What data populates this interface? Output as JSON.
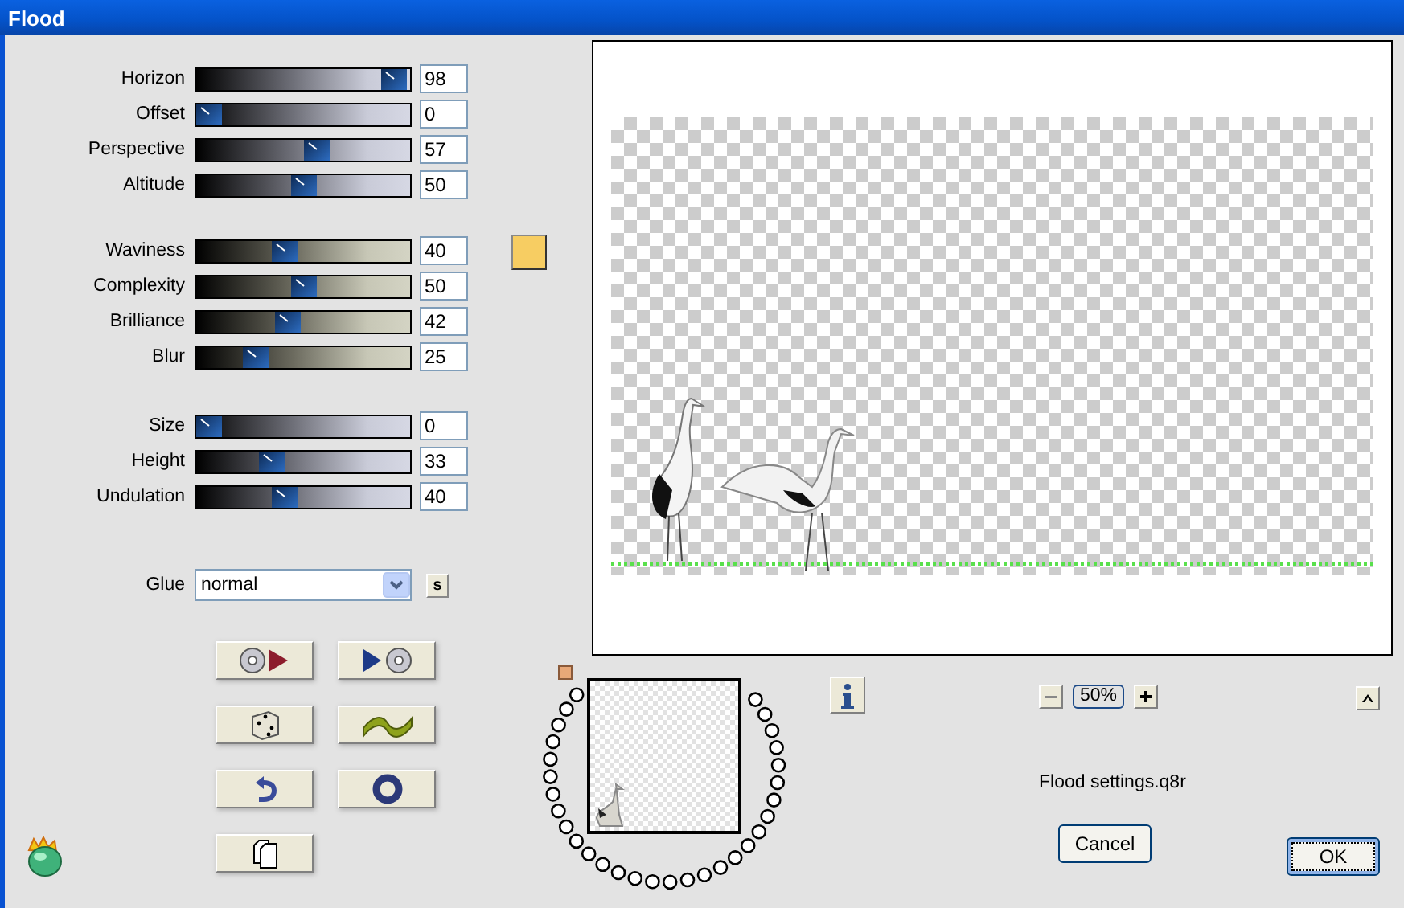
{
  "window": {
    "title": "Flood"
  },
  "slider_groups": [
    {
      "kind": "cool",
      "sliders": [
        {
          "label": "Horizon",
          "level": 0.98,
          "value": "98"
        },
        {
          "label": "Offset",
          "level": 0,
          "value": "0"
        },
        {
          "label": "Perspective",
          "level": 0.57,
          "value": "57"
        },
        {
          "label": "Altitude",
          "level": 0.5,
          "value": "50"
        }
      ]
    },
    {
      "kind": "warm",
      "sliders": [
        {
          "label": "Waviness",
          "level": 0.4,
          "value": "40"
        },
        {
          "label": "Complexity",
          "level": 0.5,
          "value": "50"
        },
        {
          "label": "Brilliance",
          "level": 0.42,
          "value": "42"
        },
        {
          "label": "Blur",
          "level": 0.25,
          "value": "25"
        }
      ]
    },
    {
      "kind": "cool",
      "sliders": [
        {
          "label": "Size",
          "level": 0,
          "value": "0"
        },
        {
          "label": "Height",
          "level": 0.33,
          "value": "33"
        },
        {
          "label": "Undulation",
          "level": 0.4,
          "value": "40"
        }
      ]
    }
  ],
  "color_swatch": {
    "color": "#f7cd62"
  },
  "glue": {
    "label": "Glue",
    "value": "normal",
    "small_button": "s"
  },
  "zoom": {
    "value": "50%"
  },
  "preset_file": "Flood settings.q8r",
  "buttons": [
    {
      "label": "Cancel",
      "default": false
    },
    {
      "label": "OK",
      "default": true
    }
  ]
}
